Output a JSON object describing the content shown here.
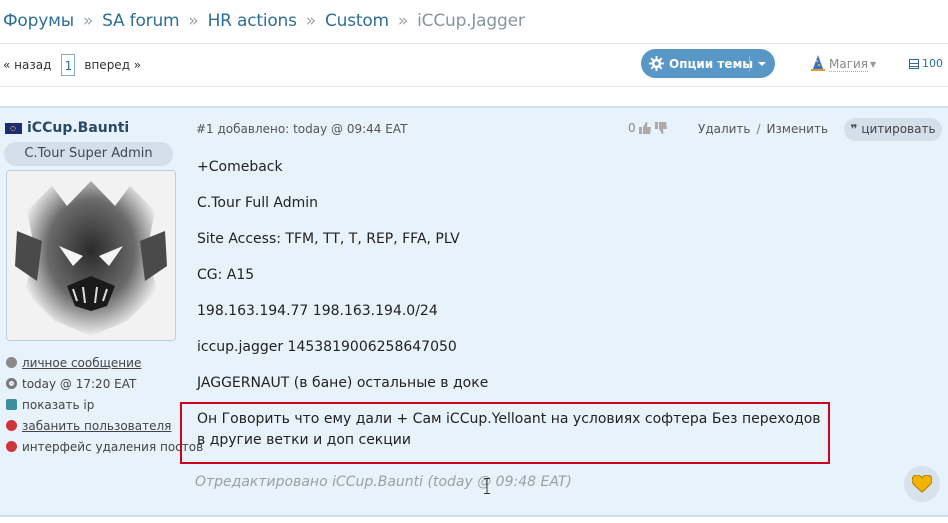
{
  "breadcrumb": {
    "items": [
      "Форумы",
      "SA forum",
      "HR actions",
      "Custom"
    ],
    "current": "iCCup.Jagger",
    "separator": "»"
  },
  "pager": {
    "prev": "« назад",
    "page": "1",
    "next": "вперед »"
  },
  "toolbar": {
    "options_label": "Опции темы",
    "magic_label": "Магия",
    "count": "100",
    "accent": "#5897c6"
  },
  "post": {
    "user": {
      "name": "iCCup.Baunti",
      "role": "C.Tour Super Admin",
      "links": [
        {
          "label": "личное сообщение",
          "icon": "message-icon"
        },
        {
          "label": "today @ 17:20 EAT",
          "icon": "clock-icon"
        },
        {
          "label": "показать ip",
          "icon": "ip-icon"
        },
        {
          "label": "забанить пользователя",
          "icon": "ban-icon"
        },
        {
          "label": "интерфейс удаления постов",
          "icon": "delete-icon"
        }
      ]
    },
    "header": "#1 добавлено: today @ 09:44 EAT",
    "votes": "0",
    "delete_label": "Удалить",
    "slash": "/",
    "edit_label": "Изменить",
    "quote_label": "цитировать",
    "lines": [
      "+Comeback",
      "C.Tour Full Admin",
      "Site Access: TFM, TT, T, REP, FFA, PLV",
      "CG: A15",
      "198.163.194.77 198.163.194.0/24",
      "iccup.jagger 1453819006258647050",
      "JAGGERNAUT (в бане) остальные в доке"
    ],
    "highlighted": "Он Говорить что ему дали + Сам iCCup.Yelloant на условиях софтера Без переходов в другие ветки и доп секции",
    "edited": "Отредактировано iCCup.Baunti (today @ 09:48 EAT)"
  }
}
